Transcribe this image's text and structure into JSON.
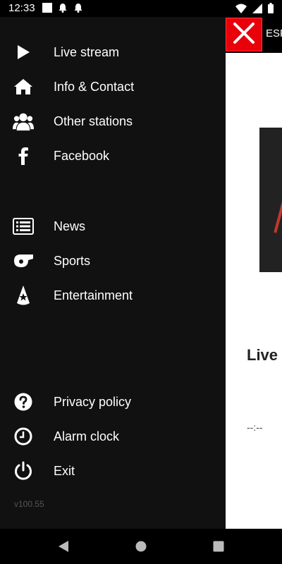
{
  "status_bar": {
    "time": "12:33",
    "left_icons": [
      "app-notification-icon",
      "bell-icon",
      "bell-icon"
    ],
    "right_icons": [
      "wifi-icon",
      "signal-icon",
      "battery-icon"
    ]
  },
  "background_app": {
    "title": "ESP",
    "live_text": "Live",
    "timer_text": "--:--",
    "accent_color": "#e8000b"
  },
  "drawer": {
    "menu_items": [
      {
        "label": "Live stream",
        "icon": "play-icon"
      },
      {
        "label": "Info & Contact",
        "icon": "home-icon"
      },
      {
        "label": "Other stations",
        "icon": "users-icon"
      },
      {
        "label": "Facebook",
        "icon": "facebook-icon"
      },
      {
        "label": "News",
        "icon": "newspaper-icon"
      },
      {
        "label": "Sports",
        "icon": "whistle-icon"
      },
      {
        "label": "Entertainment",
        "icon": "spotlight-icon"
      },
      {
        "label": "Privacy policy",
        "icon": "question-icon"
      },
      {
        "label": "Alarm clock",
        "icon": "clock-icon"
      },
      {
        "label": "Exit",
        "icon": "power-icon"
      }
    ],
    "version": "v100.55"
  },
  "nav_bar": {
    "buttons": [
      "back-icon",
      "home-icon",
      "recents-icon"
    ]
  }
}
